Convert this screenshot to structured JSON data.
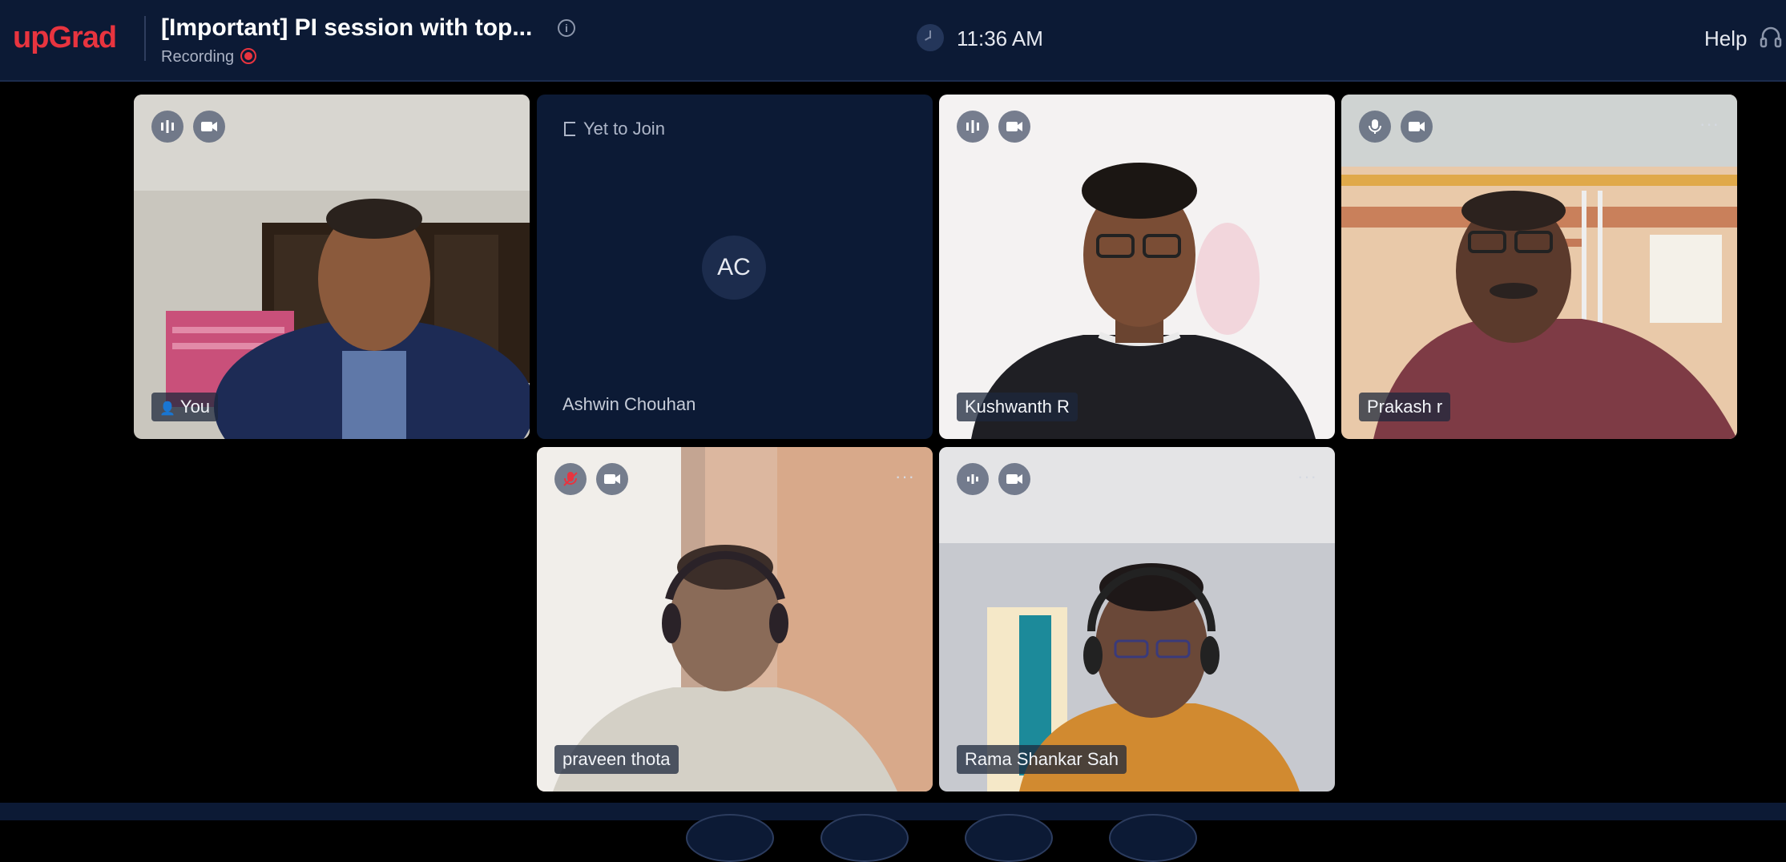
{
  "header": {
    "logo": "upGrad",
    "title": "[Important] PI session with top...",
    "recording_label": "Recording",
    "time": "11:36 AM",
    "help_label": "Help"
  },
  "participants": [
    {
      "name": "You",
      "status": "video-on",
      "mic": "speaking-icon",
      "camera": "camera-icon"
    },
    {
      "name": "Ashwin Chouhan",
      "status": "Yet to Join",
      "initials": "AC"
    },
    {
      "name": "Kushwanth R",
      "status": "video-on",
      "mic": "speaking-icon",
      "camera": "camera-icon"
    },
    {
      "name": "Prakash r",
      "status": "video-on",
      "mic": "mic-icon",
      "camera": "camera-icon"
    },
    {
      "name": "praveen thota",
      "status": "video-on",
      "mic": "mic-muted-icon",
      "camera": "camera-icon"
    },
    {
      "name": "Rama Shankar Sah",
      "status": "video-on",
      "mic": "speaking-icon",
      "camera": "camera-icon"
    }
  ],
  "more_label": "···",
  "colors": {
    "brand": "#e8343f",
    "header_bg": "#0c1a35",
    "tile_empty_bg": "#0c1a35"
  }
}
